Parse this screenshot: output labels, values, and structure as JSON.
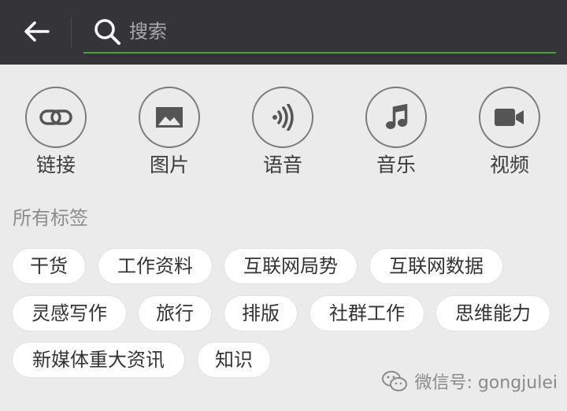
{
  "search": {
    "placeholder": "搜索"
  },
  "categories": [
    {
      "label": "链接",
      "icon": "link-icon"
    },
    {
      "label": "图片",
      "icon": "image-icon"
    },
    {
      "label": "语音",
      "icon": "voice-icon"
    },
    {
      "label": "音乐",
      "icon": "music-icon"
    },
    {
      "label": "视频",
      "icon": "video-icon"
    }
  ],
  "tags_section": {
    "title": "所有标签",
    "tags": [
      "干货",
      "工作资料",
      "互联网局势",
      "互联网数据",
      "灵感写作",
      "旅行",
      "排版",
      "社群工作",
      "思维能力",
      "新媒体重大资讯",
      "知识"
    ]
  },
  "watermark": {
    "text": "微信号: gongjulei"
  },
  "colors": {
    "topbar": "#353539",
    "accent_underline": "#46a040",
    "background": "#ebebeb",
    "tag_background": "#ffffff"
  }
}
